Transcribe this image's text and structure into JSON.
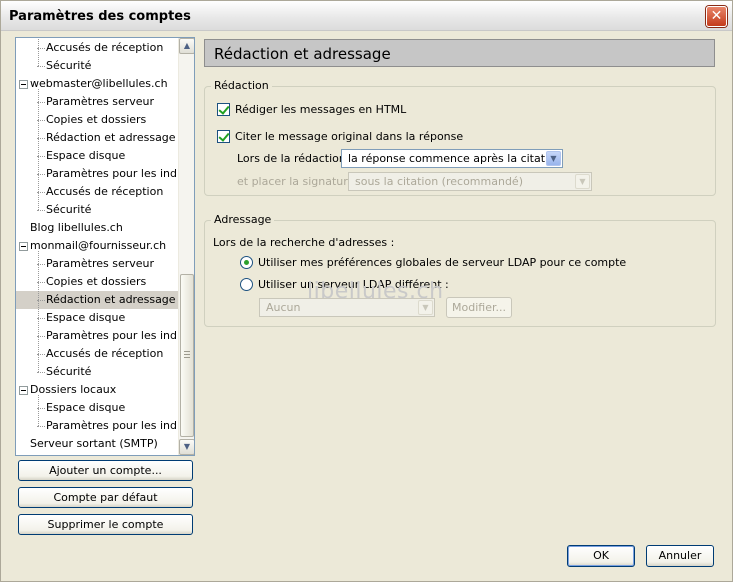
{
  "window": {
    "title": "Paramètres des comptes",
    "close_glyph": "✕"
  },
  "tree": {
    "items": [
      {
        "label": "Accusés de réception",
        "level": "child"
      },
      {
        "label": "Sécurité",
        "level": "child"
      },
      {
        "label": "webmaster@libellules.ch",
        "level": "root"
      },
      {
        "label": "Paramètres serveur",
        "level": "child"
      },
      {
        "label": "Copies et dossiers",
        "level": "child"
      },
      {
        "label": "Rédaction et adressage",
        "level": "child"
      },
      {
        "label": "Espace disque",
        "level": "child"
      },
      {
        "label": "Paramètres pour les ind...",
        "level": "child"
      },
      {
        "label": "Accusés de réception",
        "level": "child"
      },
      {
        "label": "Sécurité",
        "level": "child"
      },
      {
        "label": "Blog libellules.ch",
        "level": "leafroot"
      },
      {
        "label": "monmail@fournisseur.ch",
        "level": "root"
      },
      {
        "label": "Paramètres serveur",
        "level": "child"
      },
      {
        "label": "Copies et dossiers",
        "level": "child"
      },
      {
        "label": "Rédaction et adressage",
        "level": "child",
        "selected": true
      },
      {
        "label": "Espace disque",
        "level": "child"
      },
      {
        "label": "Paramètres pour les ind...",
        "level": "child"
      },
      {
        "label": "Accusés de réception",
        "level": "child"
      },
      {
        "label": "Sécurité",
        "level": "child"
      },
      {
        "label": "Dossiers locaux",
        "level": "root"
      },
      {
        "label": "Espace disque",
        "level": "child"
      },
      {
        "label": "Paramètres pour les ind...",
        "level": "child"
      },
      {
        "label": "Serveur sortant (SMTP)",
        "level": "leafroot"
      }
    ]
  },
  "account_buttons": {
    "add": "Ajouter un compte...",
    "default": "Compte par défaut",
    "delete": "Supprimer le compte"
  },
  "panel": {
    "title": "Rédaction et adressage",
    "redaction": {
      "group_label": "Rédaction",
      "html_checkbox": "Rédiger les messages en HTML",
      "quote_checkbox": "Citer le message original dans la réponse",
      "reply_label": "Lors de la rédaction",
      "reply_value": "la réponse commence après la citation",
      "signature_label": "et placer la signature",
      "signature_value": "sous la citation (recommandé)"
    },
    "adressage": {
      "group_label": "Adressage",
      "lookup_label": "Lors de la recherche d'adresses :",
      "radio_global": "Utiliser mes préférences globales de serveur LDAP pour ce compte",
      "radio_other": "Utiliser un serveur LDAP différent :",
      "ldap_value": "Aucun",
      "modify_button": "Modifier..."
    }
  },
  "footer": {
    "ok": "OK",
    "cancel": "Annuler"
  },
  "watermark": "libellules.ch"
}
